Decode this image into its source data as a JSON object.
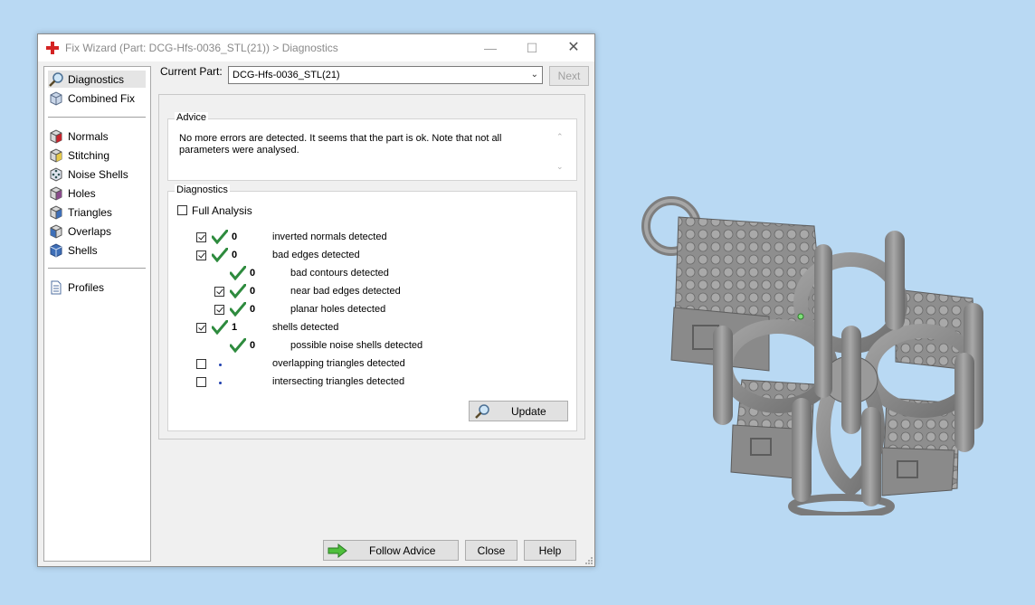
{
  "window": {
    "title": "Fix Wizard (Part: DCG-Hfs-0036_STL(21)) > Diagnostics",
    "min_glyph": "—",
    "max_glyph": "☐",
    "close_glyph": "✕"
  },
  "nav": {
    "items": [
      {
        "label": "Diagnostics",
        "icon": "magnifier-icon"
      },
      {
        "label": "Combined Fix",
        "icon": "cube-icon"
      },
      {
        "label": "Normals",
        "icon": "cube-red-icon"
      },
      {
        "label": "Stitching",
        "icon": "cube-yellow-icon"
      },
      {
        "label": "Noise Shells",
        "icon": "cube-dots-icon"
      },
      {
        "label": "Holes",
        "icon": "cube-purple-icon"
      },
      {
        "label": "Triangles",
        "icon": "cube-blue-icon"
      },
      {
        "label": "Overlaps",
        "icon": "cube-blue-icon"
      },
      {
        "label": "Shells",
        "icon": "cube-blue-icon"
      },
      {
        "label": "Profiles",
        "icon": "document-icon"
      }
    ]
  },
  "top": {
    "current_part_label": "Current Part:",
    "current_part_value": "DCG-Hfs-0036_STL(21)",
    "next_label": "Next"
  },
  "advice": {
    "label": "Advice",
    "text": "No more errors are detected. It seems that the part is ok. Note that not all parameters were analysed.",
    "scroll_up": "⌃",
    "scroll_down": "⌄"
  },
  "diagnostics": {
    "label": "Diagnostics",
    "full_analysis_label": "Full Analysis",
    "rows": [
      {
        "count": "0",
        "label": "inverted normals detected"
      },
      {
        "count": "0",
        "label": "bad edges detected"
      },
      {
        "count": "0",
        "label": "bad contours detected"
      },
      {
        "count": "0",
        "label": "near bad edges detected"
      },
      {
        "count": "0",
        "label": "planar holes detected"
      },
      {
        "count": "1",
        "label": "shells detected"
      },
      {
        "count": "0",
        "label": "possible noise shells detected"
      },
      {
        "count": "",
        "label": "overlapping triangles detected"
      },
      {
        "count": "",
        "label": "intersecting triangles detected"
      }
    ],
    "update_label": "Update"
  },
  "buttons": {
    "follow_advice": "Follow Advice",
    "close": "Close",
    "help": "Help"
  },
  "colors": {
    "desktop": "#b9d9f3",
    "check_green": "#2e8b3e",
    "model_gray": "#8a8a8a"
  }
}
